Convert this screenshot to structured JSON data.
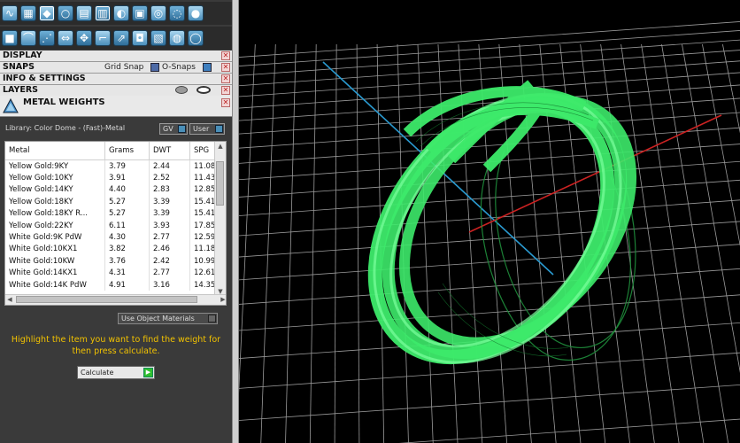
{
  "toolbar": {
    "row1_icons": [
      "move-curve-icon",
      "hatch-tool-icon",
      "gem-shape-icon",
      "ring-shape-icon",
      "document-icon",
      "grid-box-icon",
      "drop-shape-icon",
      "disk-save-icon",
      "blue-ring-icon",
      "wave-ring-icon",
      "globe-icon"
    ],
    "row2_icons": [
      "cube-tool-icon",
      "arc-tool-icon",
      "dashed-curve-icon",
      "mirror-tool-icon",
      "move-tool-icon",
      "corner-tool-icon",
      "extrude-tool-icon",
      "camera-view-icon",
      "film-view-icon",
      "globe-select-icon",
      "ring-select-icon"
    ]
  },
  "sections": {
    "display": "DISPLAY",
    "snaps": "SNAPS",
    "grid_snap": "Grid Snap",
    "o_snaps": "O-Snaps",
    "info_settings": "INFO & SETTINGS",
    "layers": "LAYERS",
    "close_glyph": "✕"
  },
  "metal_weights": {
    "title": "METAL WEIGHTS",
    "library_label": "Library: Color Dome - (Fast)-Metal",
    "gv_label": "GV",
    "user_label": "User",
    "columns": [
      "Metal",
      "Grams",
      "DWT",
      "SPG"
    ],
    "rows": [
      [
        "Yellow Gold:9KY",
        "3.79",
        "2.44",
        "11.08"
      ],
      [
        "Yellow Gold:10KY",
        "3.91",
        "2.52",
        "11.43"
      ],
      [
        "Yellow Gold:14KY",
        "4.40",
        "2.83",
        "12.85"
      ],
      [
        "Yellow Gold:18KY",
        "5.27",
        "3.39",
        "15.41"
      ],
      [
        "Yellow Gold:18KY R...",
        "5.27",
        "3.39",
        "15.41"
      ],
      [
        "Yellow Gold:22KY",
        "6.11",
        "3.93",
        "17.85"
      ],
      [
        "White Gold:9K PdW",
        "4.30",
        "2.77",
        "12.59"
      ],
      [
        "White Gold:10KX1",
        "3.82",
        "2.46",
        "11.18"
      ],
      [
        "White Gold:10KW",
        "3.76",
        "2.42",
        "10.99"
      ],
      [
        "White Gold:14KX1",
        "4.31",
        "2.77",
        "12.61"
      ],
      [
        "White Gold:14K PdW",
        "4.91",
        "3.16",
        "14.35"
      ]
    ],
    "use_object_materials": "Use Object Materials",
    "instructions": "Highlight the item you want to find the weight for then press calculate.",
    "calculate": "Calculate",
    "scroll_up": "▲",
    "scroll_down": "▼",
    "scroll_left": "◀",
    "scroll_right": "▶"
  },
  "viewport": {
    "background": "#000000",
    "grid_color": "#9a9a9a",
    "x_axis_color": "#cc2222",
    "y_axis_color": "#2a9ad0",
    "model_color": "#3dea6a",
    "model": "wireframe-ring"
  }
}
